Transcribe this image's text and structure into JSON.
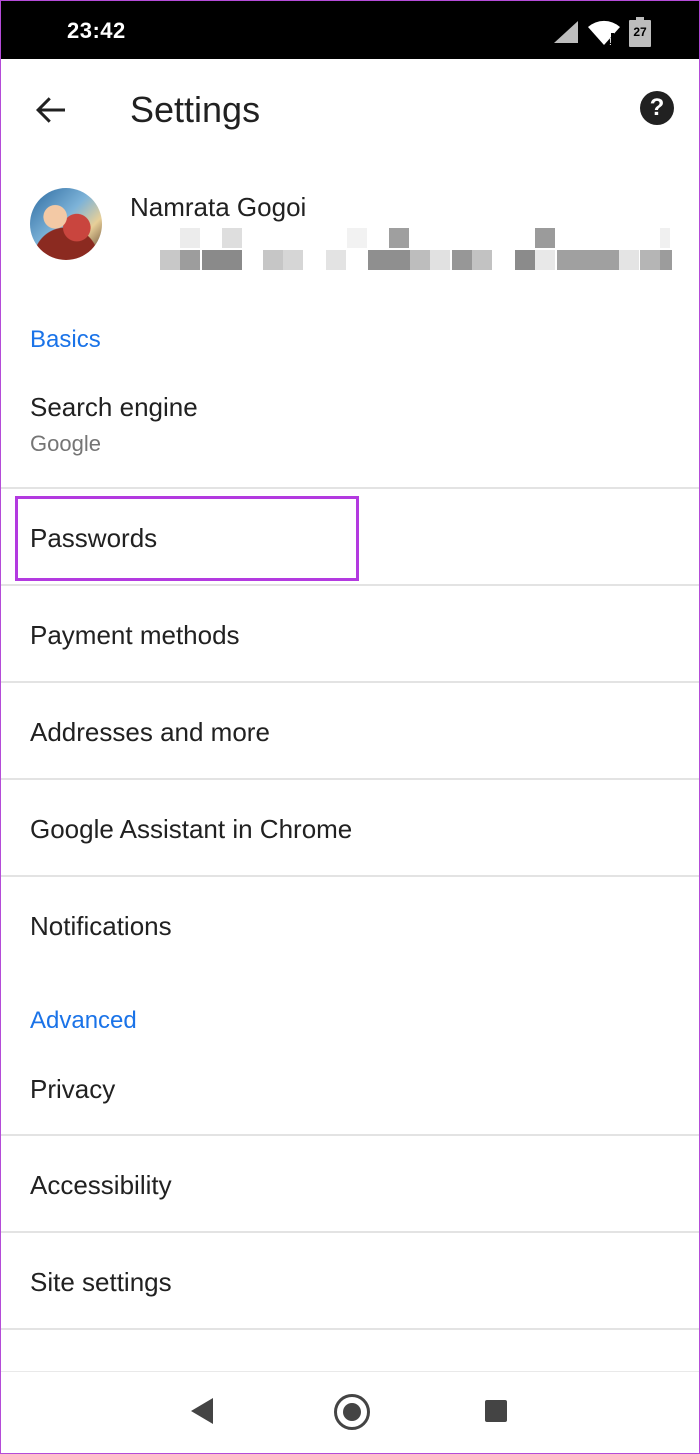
{
  "status_bar": {
    "time": "23:42",
    "battery_level": "27",
    "icons": [
      "signal-icon",
      "wifi-icon",
      "battery-icon"
    ]
  },
  "toolbar": {
    "title": "Settings",
    "back_icon": "arrow-back-icon",
    "help_icon": "help-icon",
    "help_glyph": "?"
  },
  "account": {
    "name": "Namrata Gogoi"
  },
  "sections": {
    "basics": "Basics",
    "advanced": "Advanced"
  },
  "basics_items": {
    "search_engine": {
      "label": "Search engine",
      "value": "Google"
    },
    "passwords": "Passwords",
    "payment_methods": "Payment methods",
    "addresses": "Addresses and more",
    "assistant": "Google Assistant in Chrome",
    "notifications": "Notifications"
  },
  "advanced_items": {
    "privacy": "Privacy",
    "accessibility": "Accessibility",
    "site_settings": "Site settings"
  },
  "colors": {
    "accent": "#1a73e8",
    "highlight": "#b33ae0"
  }
}
